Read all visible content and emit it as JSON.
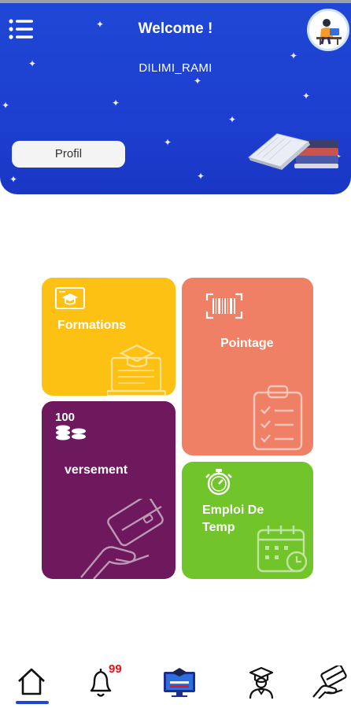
{
  "header": {
    "title": "Welcome !",
    "username": "DILIMI_RAMI",
    "profile_button": "Profil",
    "colors": {
      "background": "#1f47d6",
      "text": "#ffffff"
    }
  },
  "tiles": [
    {
      "label": "Formations",
      "icon": "graduation-laptop-icon",
      "color": "#fdc114"
    },
    {
      "label": "Pointage",
      "icon": "barcode-clipboard-icon",
      "color": "#ef8066"
    },
    {
      "label": "versement",
      "icon": "coins-card-icon",
      "color": "#6e195e",
      "coin_value": "100"
    },
    {
      "label": "Emploi De Temp",
      "label_line1": "Emploi De",
      "label_line2": "Temp",
      "icon": "stopwatch-calendar-icon",
      "color": "#72c42b"
    }
  ],
  "bottom_nav": {
    "items": [
      {
        "name": "home",
        "icon": "home-icon",
        "active": true
      },
      {
        "name": "notifications",
        "icon": "bell-icon",
        "badge": "99"
      },
      {
        "name": "courses",
        "icon": "monitor-graduation-icon"
      },
      {
        "name": "student",
        "icon": "graduate-user-icon"
      },
      {
        "name": "payments",
        "icon": "hand-card-icon"
      }
    ],
    "active_color": "#1f47d6",
    "badge_color": "#e4161b"
  }
}
